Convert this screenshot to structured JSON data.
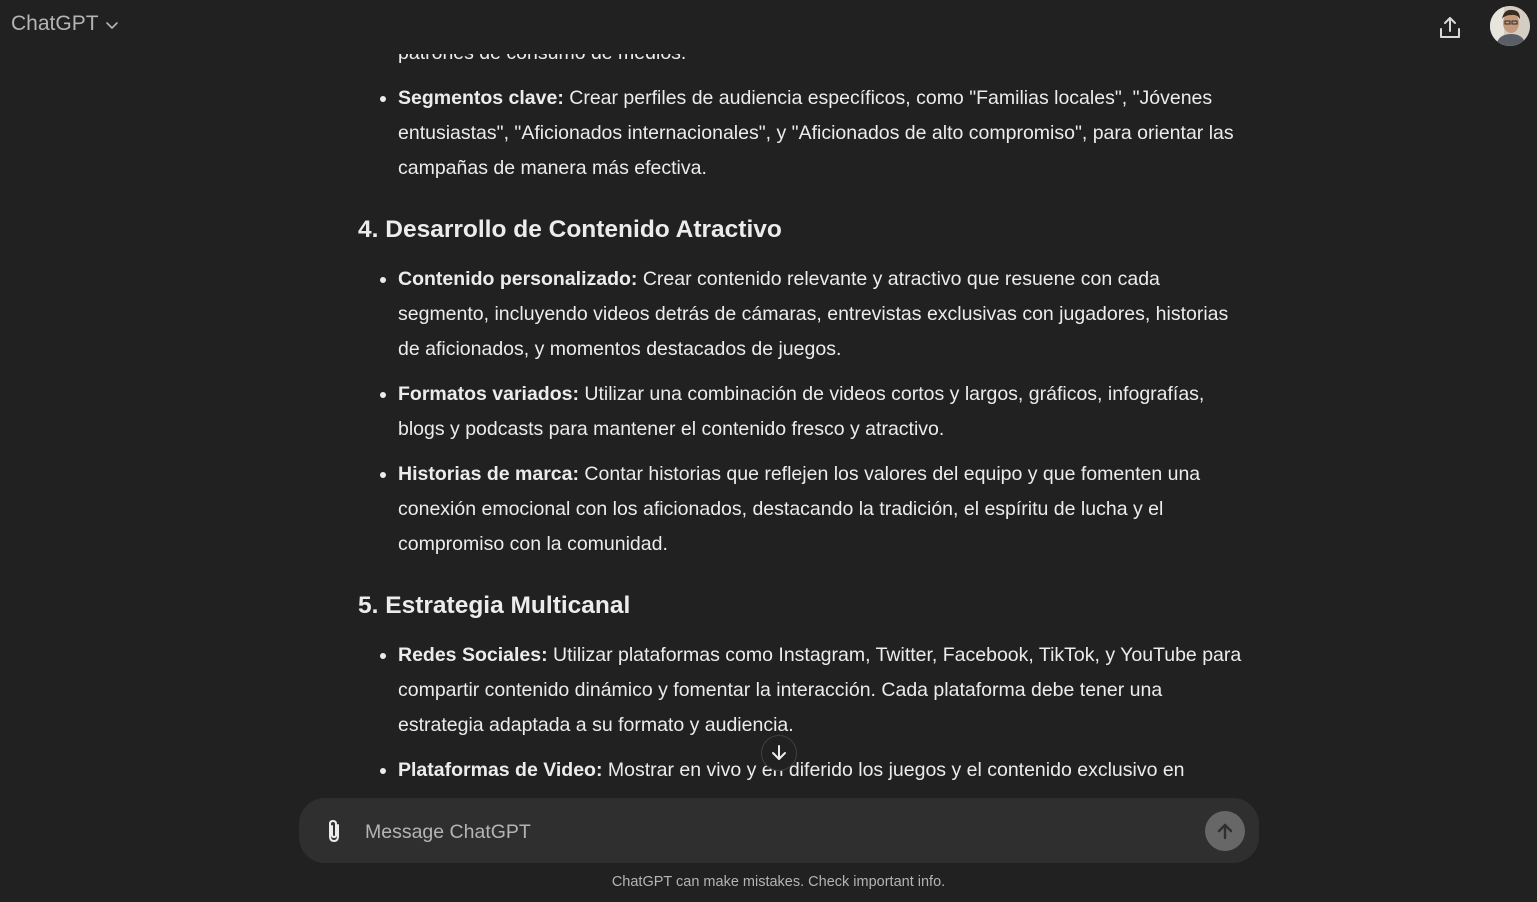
{
  "app": {
    "model_label": "ChatGPT"
  },
  "message": {
    "top_fragment": "patrones de consumo de medios.",
    "section3_items": [
      {
        "title": "Segmentos clave:",
        "text": " Crear perfiles de audiencia específicos, como \"Familias locales\", \"Jóvenes entusiastas\", \"Aficionados internacionales\", y \"Aficionados de alto compromiso\", para orientar las campañas de manera más efectiva."
      }
    ],
    "section4": {
      "number": "4. ",
      "title": "Desarrollo de Contenido Atractivo",
      "items": [
        {
          "title": "Contenido personalizado:",
          "text": " Crear contenido relevante y atractivo que resuene con cada segmento, incluyendo videos detrás de cámaras, entrevistas exclusivas con jugadores, historias de aficionados, y momentos destacados de juegos."
        },
        {
          "title": "Formatos variados:",
          "text": " Utilizar una combinación de videos cortos y largos, gráficos, infografías, blogs y podcasts para mantener el contenido fresco y atractivo."
        },
        {
          "title": "Historias de marca:",
          "text": " Contar historias que reflejen los valores del equipo y que fomenten una conexión emocional con los aficionados, destacando la tradición, el espíritu de lucha y el compromiso con la comunidad."
        }
      ]
    },
    "section5": {
      "number": "5. ",
      "title": "Estrategia Multicanal",
      "items": [
        {
          "title": "Redes Sociales:",
          "text": " Utilizar plataformas como Instagram, Twitter, Facebook, TikTok, y YouTube para compartir contenido dinámico y fomentar la interacción. Cada plataforma debe tener una estrategia adaptada a su formato y audiencia."
        },
        {
          "title": "Plataformas de Video:",
          "text": " Mostrar en vivo y en diferido los juegos y el contenido exclusivo en plataformas de streaming."
        }
      ]
    }
  },
  "composer": {
    "placeholder": "Message ChatGPT"
  },
  "footer": {
    "disclaimer": "ChatGPT can make mistakes. Check important info."
  },
  "icons": {
    "model_menu": "chevron-down-icon",
    "share": "share-icon",
    "attach": "paperclip-icon",
    "send": "arrow-up-icon",
    "scroll": "arrow-down-icon"
  },
  "colors": {
    "background": "#212121",
    "composer": "#2f2f2f",
    "text": "#ececec",
    "muted": "#b4b4b4",
    "send_button": "#676767"
  }
}
